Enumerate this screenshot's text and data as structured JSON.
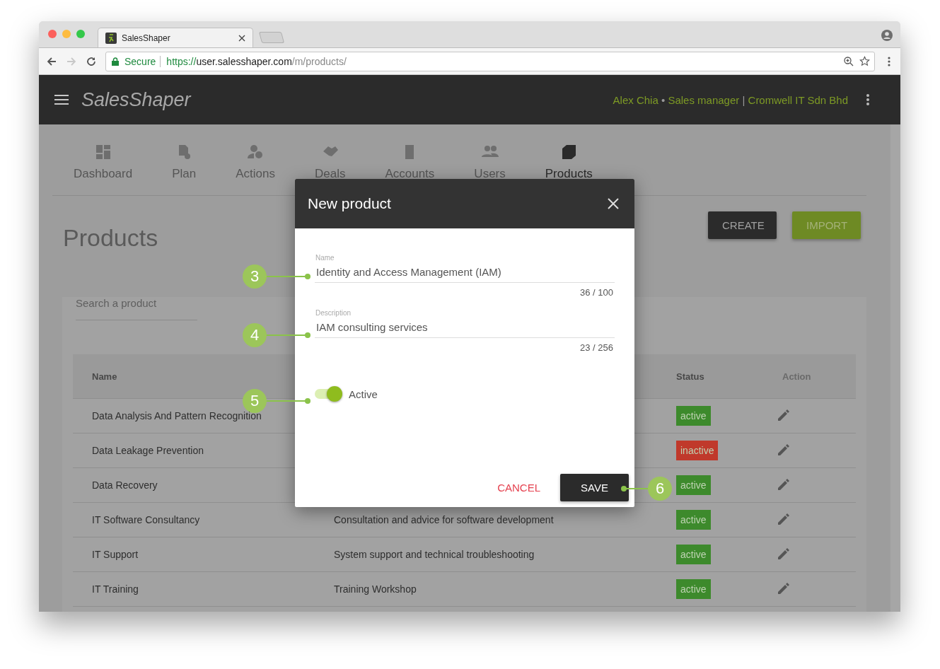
{
  "browser": {
    "tab_title": "SalesShaper",
    "secure_label": "Secure",
    "url_scheme": "https://",
    "url_host": "user.salesshaper.com",
    "url_path": "/m/products/"
  },
  "app": {
    "logo": "SalesShaper",
    "user_name": "Alex Chia",
    "separator_dot": "•",
    "user_role": "Sales manager",
    "separator_bar": "|",
    "company": "Cromwell IT Sdn Bhd"
  },
  "nav": [
    {
      "label": "Dashboard",
      "kind": "dashboard",
      "selected": false
    },
    {
      "label": "Plan",
      "kind": "plan",
      "selected": false
    },
    {
      "label": "Actions",
      "kind": "actions",
      "selected": false
    },
    {
      "label": "Deals",
      "kind": "deals",
      "selected": false
    },
    {
      "label": "Accounts",
      "kind": "accounts",
      "selected": false
    },
    {
      "label": "Users",
      "kind": "users",
      "selected": false
    },
    {
      "label": "Products",
      "kind": "products",
      "selected": true
    }
  ],
  "page": {
    "title": "Products",
    "buttons": [
      {
        "label": "CREATE",
        "kind": "dark"
      },
      {
        "label": "IMPORT",
        "kind": "green"
      }
    ],
    "search": {
      "placeholder": "Search a product"
    }
  },
  "table": {
    "columns": {
      "name": "Name",
      "status": "Status",
      "action": "Action"
    },
    "rows": [
      {
        "name": "Data Analysis And Pattern Recognition",
        "status": "active",
        "color": "#3d8a2c"
      },
      {
        "name": "Data Leakage Prevention",
        "status": "inactive",
        "color": "#c0392b"
      },
      {
        "name": "Data Recovery",
        "status": "active",
        "color": "#3d8a2c"
      },
      {
        "name": "IT Software Consultancy",
        "description": "Consultation and advice for software development",
        "status": "active",
        "color": "#3d8a2c"
      },
      {
        "name": "IT Support",
        "description": "System support and technical troubleshooting",
        "status": "active",
        "color": "#3d8a2c"
      },
      {
        "name": "IT Training",
        "description": "Training Workshop",
        "status": "active",
        "color": "#3d8a2c"
      }
    ]
  },
  "dialog": {
    "title": "New product",
    "fields": [
      {
        "label": "Name",
        "value": "Identity and Access Management (IAM)",
        "counter": "36 / 100"
      },
      {
        "label": "Description",
        "value": "IAM consulting services",
        "counter": "23 / 256"
      }
    ],
    "toggle": {
      "label": "Active",
      "on": true
    },
    "cancel": "CANCEL",
    "save": "SAVE"
  },
  "callouts": [
    {
      "label": "3"
    },
    {
      "label": "4"
    },
    {
      "label": "5"
    },
    {
      "label": "6"
    }
  ]
}
